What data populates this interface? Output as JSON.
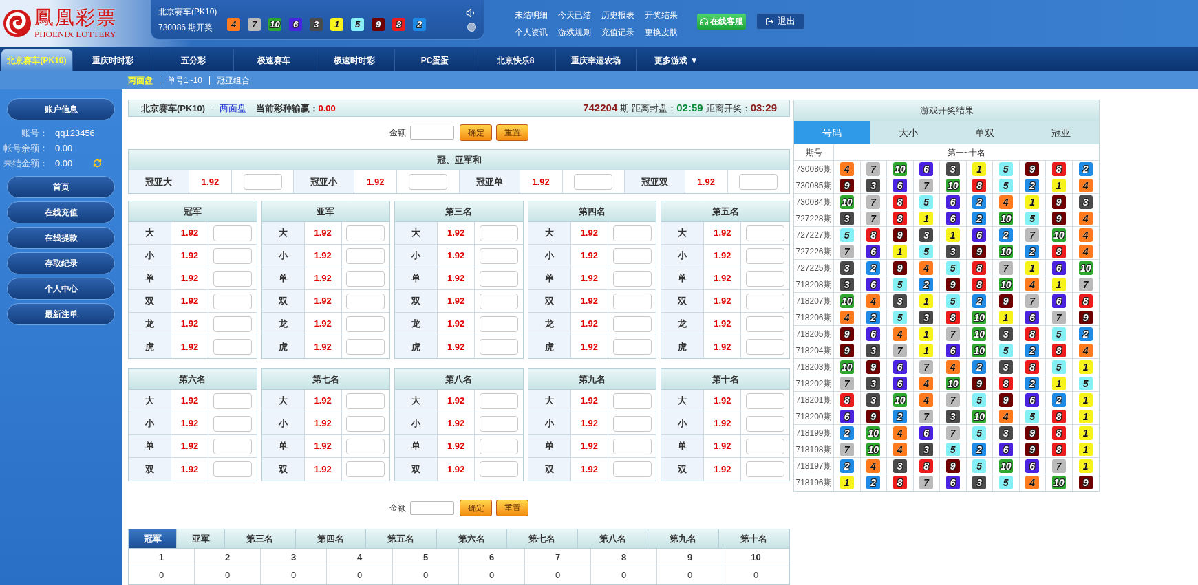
{
  "logo": {
    "title": "鳳凰彩票",
    "subtitle": "PHOENIX LOTTERY"
  },
  "latest": {
    "game": "北京赛车(PK10)",
    "period": "730086 期开奖",
    "balls": [
      {
        "n": "4",
        "color": "#ff7a1c"
      },
      {
        "n": "7",
        "color": "#bababa"
      },
      {
        "n": "10",
        "color": "#2fa82f"
      },
      {
        "n": "6",
        "color": "#4b22e0"
      },
      {
        "n": "3",
        "color": "#4a4a4a"
      },
      {
        "n": "1",
        "color": "#f7f21a"
      },
      {
        "n": "5",
        "color": "#82f0f5"
      },
      {
        "n": "9",
        "color": "#700000"
      },
      {
        "n": "8",
        "color": "#ec1c1c"
      },
      {
        "n": "2",
        "color": "#1e8ce6"
      }
    ]
  },
  "top_links": [
    "未结明细",
    "今天已结",
    "历史报表",
    "开奖结果",
    "个人资讯",
    "游戏规则",
    "充值记录",
    "更换皮肤"
  ],
  "support_button": "在线客服",
  "logout_button": "退出",
  "nav_tabs": [
    {
      "label": "北京赛车(PK10)",
      "selected": true
    },
    {
      "label": "重庆时时彩",
      "selected": false
    },
    {
      "label": "五分彩",
      "selected": false
    },
    {
      "label": "极速赛车",
      "selected": false
    },
    {
      "label": "极速时时彩",
      "selected": false
    },
    {
      "label": "PC蛋蛋",
      "selected": false
    },
    {
      "label": "北京快乐8",
      "selected": false
    },
    {
      "label": "重庆幸运农场",
      "selected": false
    },
    {
      "label": "更多游戏 ▼",
      "selected": false
    }
  ],
  "subnav": [
    {
      "label": "两面盘",
      "selected": true
    },
    {
      "label": "单号1~10",
      "selected": false
    },
    {
      "label": "冠亚组合",
      "selected": false
    }
  ],
  "sidebar": {
    "title": "账户信息",
    "fields": [
      {
        "label": "账号：",
        "value": "qq123456"
      },
      {
        "label": "帐号余额：",
        "value": "0.00"
      },
      {
        "label": "未结金额：",
        "value": "0.00"
      }
    ],
    "menu": [
      "首页",
      "在线充值",
      "在线提款",
      "存取纪录",
      "个人中心",
      "最新注单"
    ]
  },
  "bet_header": {
    "game": "北京赛车(PK10)",
    "separator": "-",
    "market": "两面盘",
    "profit_label": "当前彩种输赢：",
    "profit": "0.00",
    "period": "742204",
    "period_suffix": "期",
    "close_label": "距离封盘：",
    "close_time": "02:59",
    "open_label": "距离开奖：",
    "open_time": "03:29"
  },
  "amount_bar_top": {
    "label": "金额",
    "confirm": "确定",
    "reset": "重置"
  },
  "sum_section": {
    "title": "冠、亚军和",
    "options": [
      {
        "label": "冠亚大",
        "odds": "1.92"
      },
      {
        "label": "冠亚小",
        "odds": "1.92"
      },
      {
        "label": "冠亚单",
        "odds": "1.92"
      },
      {
        "label": "冠亚双",
        "odds": "1.92"
      }
    ]
  },
  "positions_row1": [
    {
      "title": "冠军",
      "options": [
        {
          "label": "大",
          "odds": "1.92"
        },
        {
          "label": "小",
          "odds": "1.92"
        },
        {
          "label": "单",
          "odds": "1.92"
        },
        {
          "label": "双",
          "odds": "1.92"
        },
        {
          "label": "龙",
          "odds": "1.92"
        },
        {
          "label": "虎",
          "odds": "1.92"
        }
      ]
    },
    {
      "title": "亚军",
      "options": [
        {
          "label": "大",
          "odds": "1.92"
        },
        {
          "label": "小",
          "odds": "1.92"
        },
        {
          "label": "单",
          "odds": "1.92"
        },
        {
          "label": "双",
          "odds": "1.92"
        },
        {
          "label": "龙",
          "odds": "1.92"
        },
        {
          "label": "虎",
          "odds": "1.92"
        }
      ]
    },
    {
      "title": "第三名",
      "options": [
        {
          "label": "大",
          "odds": "1.92"
        },
        {
          "label": "小",
          "odds": "1.92"
        },
        {
          "label": "单",
          "odds": "1.92"
        },
        {
          "label": "双",
          "odds": "1.92"
        },
        {
          "label": "龙",
          "odds": "1.92"
        },
        {
          "label": "虎",
          "odds": "1.92"
        }
      ]
    },
    {
      "title": "第四名",
      "options": [
        {
          "label": "大",
          "odds": "1.92"
        },
        {
          "label": "小",
          "odds": "1.92"
        },
        {
          "label": "单",
          "odds": "1.92"
        },
        {
          "label": "双",
          "odds": "1.92"
        },
        {
          "label": "龙",
          "odds": "1.92"
        },
        {
          "label": "虎",
          "odds": "1.92"
        }
      ]
    },
    {
      "title": "第五名",
      "options": [
        {
          "label": "大",
          "odds": "1.92"
        },
        {
          "label": "小",
          "odds": "1.92"
        },
        {
          "label": "单",
          "odds": "1.92"
        },
        {
          "label": "双",
          "odds": "1.92"
        },
        {
          "label": "龙",
          "odds": "1.92"
        },
        {
          "label": "虎",
          "odds": "1.92"
        }
      ]
    }
  ],
  "positions_row2": [
    {
      "title": "第六名",
      "options": [
        {
          "label": "大",
          "odds": "1.92"
        },
        {
          "label": "小",
          "odds": "1.92"
        },
        {
          "label": "单",
          "odds": "1.92"
        },
        {
          "label": "双",
          "odds": "1.92"
        }
      ]
    },
    {
      "title": "第七名",
      "options": [
        {
          "label": "大",
          "odds": "1.92"
        },
        {
          "label": "小",
          "odds": "1.92"
        },
        {
          "label": "单",
          "odds": "1.92"
        },
        {
          "label": "双",
          "odds": "1.92"
        }
      ]
    },
    {
      "title": "第八名",
      "options": [
        {
          "label": "大",
          "odds": "1.92"
        },
        {
          "label": "小",
          "odds": "1.92"
        },
        {
          "label": "单",
          "odds": "1.92"
        },
        {
          "label": "双",
          "odds": "1.92"
        }
      ]
    },
    {
      "title": "第九名",
      "options": [
        {
          "label": "大",
          "odds": "1.92"
        },
        {
          "label": "小",
          "odds": "1.92"
        },
        {
          "label": "单",
          "odds": "1.92"
        },
        {
          "label": "双",
          "odds": "1.92"
        }
      ]
    },
    {
      "title": "第十名",
      "options": [
        {
          "label": "大",
          "odds": "1.92"
        },
        {
          "label": "小",
          "odds": "1.92"
        },
        {
          "label": "单",
          "odds": "1.92"
        },
        {
          "label": "双",
          "odds": "1.92"
        }
      ]
    }
  ],
  "amount_bar_bottom": {
    "label": "金额",
    "confirm": "确定",
    "reset": "重置"
  },
  "stats_table": {
    "tabs": [
      {
        "label": "冠军",
        "selected": true
      },
      {
        "label": "亚军",
        "selected": false
      },
      {
        "label": "第三名",
        "selected": false
      },
      {
        "label": "第四名",
        "selected": false
      },
      {
        "label": "第五名",
        "selected": false
      },
      {
        "label": "第六名",
        "selected": false
      },
      {
        "label": "第七名",
        "selected": false
      },
      {
        "label": "第八名",
        "selected": false
      },
      {
        "label": "第九名",
        "selected": false
      },
      {
        "label": "第十名",
        "selected": false
      }
    ],
    "numbers": [
      "1",
      "2",
      "3",
      "4",
      "5",
      "6",
      "7",
      "8",
      "9",
      "10"
    ],
    "counts": [
      "0",
      "0",
      "0",
      "0",
      "0",
      "0",
      "0",
      "0",
      "0",
      "0"
    ]
  },
  "results": {
    "title": "游戏开奖结果",
    "tabs": [
      {
        "label": "号码",
        "selected": true
      },
      {
        "label": "大小",
        "selected": false
      },
      {
        "label": "单双",
        "selected": false
      },
      {
        "label": "冠亚",
        "selected": false
      }
    ],
    "columns": [
      "期号",
      "第一~十名"
    ],
    "rows": [
      {
        "period": "730086期",
        "balls": [
          {
            "n": "4",
            "color": "#ff7a1c"
          },
          {
            "n": "7",
            "color": "#bababa"
          },
          {
            "n": "10",
            "color": "#2fa82f"
          },
          {
            "n": "6",
            "color": "#4b22e0"
          },
          {
            "n": "3",
            "color": "#4a4a4a"
          },
          {
            "n": "1",
            "color": "#f7f21a"
          },
          {
            "n": "5",
            "color": "#82f0f5"
          },
          {
            "n": "9",
            "color": "#700000"
          },
          {
            "n": "8",
            "color": "#ec1c1c"
          },
          {
            "n": "2",
            "color": "#1e8ce6"
          }
        ]
      },
      {
        "period": "730085期",
        "balls": [
          {
            "n": "9",
            "color": "#700000"
          },
          {
            "n": "3",
            "color": "#4a4a4a"
          },
          {
            "n": "6",
            "color": "#4b22e0"
          },
          {
            "n": "7",
            "color": "#bababa"
          },
          {
            "n": "10",
            "color": "#2fa82f"
          },
          {
            "n": "8",
            "color": "#ec1c1c"
          },
          {
            "n": "5",
            "color": "#82f0f5"
          },
          {
            "n": "2",
            "color": "#1e8ce6"
          },
          {
            "n": "1",
            "color": "#f7f21a"
          },
          {
            "n": "4",
            "color": "#ff7a1c"
          }
        ]
      },
      {
        "period": "730084期",
        "balls": [
          {
            "n": "10",
            "color": "#2fa82f"
          },
          {
            "n": "7",
            "color": "#bababa"
          },
          {
            "n": "8",
            "color": "#ec1c1c"
          },
          {
            "n": "5",
            "color": "#82f0f5"
          },
          {
            "n": "6",
            "color": "#4b22e0"
          },
          {
            "n": "2",
            "color": "#1e8ce6"
          },
          {
            "n": "4",
            "color": "#ff7a1c"
          },
          {
            "n": "1",
            "color": "#f7f21a"
          },
          {
            "n": "9",
            "color": "#700000"
          },
          {
            "n": "3",
            "color": "#4a4a4a"
          }
        ]
      },
      {
        "period": "727228期",
        "balls": [
          {
            "n": "3",
            "color": "#4a4a4a"
          },
          {
            "n": "7",
            "color": "#bababa"
          },
          {
            "n": "8",
            "color": "#ec1c1c"
          },
          {
            "n": "1",
            "color": "#f7f21a"
          },
          {
            "n": "6",
            "color": "#4b22e0"
          },
          {
            "n": "2",
            "color": "#1e8ce6"
          },
          {
            "n": "10",
            "color": "#2fa82f"
          },
          {
            "n": "5",
            "color": "#82f0f5"
          },
          {
            "n": "9",
            "color": "#700000"
          },
          {
            "n": "4",
            "color": "#ff7a1c"
          }
        ]
      },
      {
        "period": "727227期",
        "balls": [
          {
            "n": "5",
            "color": "#82f0f5"
          },
          {
            "n": "8",
            "color": "#ec1c1c"
          },
          {
            "n": "9",
            "color": "#700000"
          },
          {
            "n": "3",
            "color": "#4a4a4a"
          },
          {
            "n": "1",
            "color": "#f7f21a"
          },
          {
            "n": "6",
            "color": "#4b22e0"
          },
          {
            "n": "2",
            "color": "#1e8ce6"
          },
          {
            "n": "7",
            "color": "#bababa"
          },
          {
            "n": "10",
            "color": "#2fa82f"
          },
          {
            "n": "4",
            "color": "#ff7a1c"
          }
        ]
      },
      {
        "period": "727226期",
        "balls": [
          {
            "n": "7",
            "color": "#bababa"
          },
          {
            "n": "6",
            "color": "#4b22e0"
          },
          {
            "n": "1",
            "color": "#f7f21a"
          },
          {
            "n": "5",
            "color": "#82f0f5"
          },
          {
            "n": "3",
            "color": "#4a4a4a"
          },
          {
            "n": "9",
            "color": "#700000"
          },
          {
            "n": "10",
            "color": "#2fa82f"
          },
          {
            "n": "2",
            "color": "#1e8ce6"
          },
          {
            "n": "8",
            "color": "#ec1c1c"
          },
          {
            "n": "4",
            "color": "#ff7a1c"
          }
        ]
      },
      {
        "period": "727225期",
        "balls": [
          {
            "n": "3",
            "color": "#4a4a4a"
          },
          {
            "n": "2",
            "color": "#1e8ce6"
          },
          {
            "n": "9",
            "color": "#700000"
          },
          {
            "n": "4",
            "color": "#ff7a1c"
          },
          {
            "n": "5",
            "color": "#82f0f5"
          },
          {
            "n": "8",
            "color": "#ec1c1c"
          },
          {
            "n": "7",
            "color": "#bababa"
          },
          {
            "n": "1",
            "color": "#f7f21a"
          },
          {
            "n": "6",
            "color": "#4b22e0"
          },
          {
            "n": "10",
            "color": "#2fa82f"
          }
        ]
      },
      {
        "period": "718208期",
        "balls": [
          {
            "n": "3",
            "color": "#4a4a4a"
          },
          {
            "n": "6",
            "color": "#4b22e0"
          },
          {
            "n": "5",
            "color": "#82f0f5"
          },
          {
            "n": "2",
            "color": "#1e8ce6"
          },
          {
            "n": "9",
            "color": "#700000"
          },
          {
            "n": "8",
            "color": "#ec1c1c"
          },
          {
            "n": "10",
            "color": "#2fa82f"
          },
          {
            "n": "4",
            "color": "#ff7a1c"
          },
          {
            "n": "1",
            "color": "#f7f21a"
          },
          {
            "n": "7",
            "color": "#bababa"
          }
        ]
      },
      {
        "period": "718207期",
        "balls": [
          {
            "n": "10",
            "color": "#2fa82f"
          },
          {
            "n": "4",
            "color": "#ff7a1c"
          },
          {
            "n": "3",
            "color": "#4a4a4a"
          },
          {
            "n": "1",
            "color": "#f7f21a"
          },
          {
            "n": "5",
            "color": "#82f0f5"
          },
          {
            "n": "2",
            "color": "#1e8ce6"
          },
          {
            "n": "9",
            "color": "#700000"
          },
          {
            "n": "7",
            "color": "#bababa"
          },
          {
            "n": "6",
            "color": "#4b22e0"
          },
          {
            "n": "8",
            "color": "#ec1c1c"
          }
        ]
      },
      {
        "period": "718206期",
        "balls": [
          {
            "n": "4",
            "color": "#ff7a1c"
          },
          {
            "n": "2",
            "color": "#1e8ce6"
          },
          {
            "n": "5",
            "color": "#82f0f5"
          },
          {
            "n": "3",
            "color": "#4a4a4a"
          },
          {
            "n": "8",
            "color": "#ec1c1c"
          },
          {
            "n": "10",
            "color": "#2fa82f"
          },
          {
            "n": "1",
            "color": "#f7f21a"
          },
          {
            "n": "6",
            "color": "#4b22e0"
          },
          {
            "n": "7",
            "color": "#bababa"
          },
          {
            "n": "9",
            "color": "#700000"
          }
        ]
      },
      {
        "period": "718205期",
        "balls": [
          {
            "n": "9",
            "color": "#700000"
          },
          {
            "n": "6",
            "color": "#4b22e0"
          },
          {
            "n": "4",
            "color": "#ff7a1c"
          },
          {
            "n": "1",
            "color": "#f7f21a"
          },
          {
            "n": "7",
            "color": "#bababa"
          },
          {
            "n": "10",
            "color": "#2fa82f"
          },
          {
            "n": "3",
            "color": "#4a4a4a"
          },
          {
            "n": "8",
            "color": "#ec1c1c"
          },
          {
            "n": "5",
            "color": "#82f0f5"
          },
          {
            "n": "2",
            "color": "#1e8ce6"
          }
        ]
      },
      {
        "period": "718204期",
        "balls": [
          {
            "n": "9",
            "color": "#700000"
          },
          {
            "n": "3",
            "color": "#4a4a4a"
          },
          {
            "n": "7",
            "color": "#bababa"
          },
          {
            "n": "1",
            "color": "#f7f21a"
          },
          {
            "n": "6",
            "color": "#4b22e0"
          },
          {
            "n": "10",
            "color": "#2fa82f"
          },
          {
            "n": "5",
            "color": "#82f0f5"
          },
          {
            "n": "2",
            "color": "#1e8ce6"
          },
          {
            "n": "8",
            "color": "#ec1c1c"
          },
          {
            "n": "4",
            "color": "#ff7a1c"
          }
        ]
      },
      {
        "period": "718203期",
        "balls": [
          {
            "n": "10",
            "color": "#2fa82f"
          },
          {
            "n": "9",
            "color": "#700000"
          },
          {
            "n": "6",
            "color": "#4b22e0"
          },
          {
            "n": "7",
            "color": "#bababa"
          },
          {
            "n": "4",
            "color": "#ff7a1c"
          },
          {
            "n": "2",
            "color": "#1e8ce6"
          },
          {
            "n": "3",
            "color": "#4a4a4a"
          },
          {
            "n": "8",
            "color": "#ec1c1c"
          },
          {
            "n": "5",
            "color": "#82f0f5"
          },
          {
            "n": "1",
            "color": "#f7f21a"
          }
        ]
      },
      {
        "period": "718202期",
        "balls": [
          {
            "n": "7",
            "color": "#bababa"
          },
          {
            "n": "3",
            "color": "#4a4a4a"
          },
          {
            "n": "6",
            "color": "#4b22e0"
          },
          {
            "n": "4",
            "color": "#ff7a1c"
          },
          {
            "n": "10",
            "color": "#2fa82f"
          },
          {
            "n": "9",
            "color": "#700000"
          },
          {
            "n": "8",
            "color": "#ec1c1c"
          },
          {
            "n": "2",
            "color": "#1e8ce6"
          },
          {
            "n": "1",
            "color": "#f7f21a"
          },
          {
            "n": "5",
            "color": "#82f0f5"
          }
        ]
      },
      {
        "period": "718201期",
        "balls": [
          {
            "n": "8",
            "color": "#ec1c1c"
          },
          {
            "n": "3",
            "color": "#4a4a4a"
          },
          {
            "n": "10",
            "color": "#2fa82f"
          },
          {
            "n": "4",
            "color": "#ff7a1c"
          },
          {
            "n": "7",
            "color": "#bababa"
          },
          {
            "n": "5",
            "color": "#82f0f5"
          },
          {
            "n": "9",
            "color": "#700000"
          },
          {
            "n": "6",
            "color": "#4b22e0"
          },
          {
            "n": "2",
            "color": "#1e8ce6"
          },
          {
            "n": "1",
            "color": "#f7f21a"
          }
        ]
      },
      {
        "period": "718200期",
        "balls": [
          {
            "n": "6",
            "color": "#4b22e0"
          },
          {
            "n": "9",
            "color": "#700000"
          },
          {
            "n": "2",
            "color": "#1e8ce6"
          },
          {
            "n": "7",
            "color": "#bababa"
          },
          {
            "n": "3",
            "color": "#4a4a4a"
          },
          {
            "n": "10",
            "color": "#2fa82f"
          },
          {
            "n": "4",
            "color": "#ff7a1c"
          },
          {
            "n": "5",
            "color": "#82f0f5"
          },
          {
            "n": "8",
            "color": "#ec1c1c"
          },
          {
            "n": "1",
            "color": "#f7f21a"
          }
        ]
      },
      {
        "period": "718199期",
        "balls": [
          {
            "n": "2",
            "color": "#1e8ce6"
          },
          {
            "n": "10",
            "color": "#2fa82f"
          },
          {
            "n": "4",
            "color": "#ff7a1c"
          },
          {
            "n": "6",
            "color": "#4b22e0"
          },
          {
            "n": "7",
            "color": "#bababa"
          },
          {
            "n": "5",
            "color": "#82f0f5"
          },
          {
            "n": "3",
            "color": "#4a4a4a"
          },
          {
            "n": "9",
            "color": "#700000"
          },
          {
            "n": "8",
            "color": "#ec1c1c"
          },
          {
            "n": "1",
            "color": "#f7f21a"
          }
        ]
      },
      {
        "period": "718198期",
        "balls": [
          {
            "n": "7",
            "color": "#bababa"
          },
          {
            "n": "10",
            "color": "#2fa82f"
          },
          {
            "n": "4",
            "color": "#ff7a1c"
          },
          {
            "n": "3",
            "color": "#4a4a4a"
          },
          {
            "n": "5",
            "color": "#82f0f5"
          },
          {
            "n": "2",
            "color": "#1e8ce6"
          },
          {
            "n": "6",
            "color": "#4b22e0"
          },
          {
            "n": "9",
            "color": "#700000"
          },
          {
            "n": "8",
            "color": "#ec1c1c"
          },
          {
            "n": "1",
            "color": "#f7f21a"
          }
        ]
      },
      {
        "period": "718197期",
        "balls": [
          {
            "n": "2",
            "color": "#1e8ce6"
          },
          {
            "n": "4",
            "color": "#ff7a1c"
          },
          {
            "n": "3",
            "color": "#4a4a4a"
          },
          {
            "n": "8",
            "color": "#ec1c1c"
          },
          {
            "n": "9",
            "color": "#700000"
          },
          {
            "n": "5",
            "color": "#82f0f5"
          },
          {
            "n": "10",
            "color": "#2fa82f"
          },
          {
            "n": "6",
            "color": "#4b22e0"
          },
          {
            "n": "7",
            "color": "#bababa"
          },
          {
            "n": "1",
            "color": "#f7f21a"
          }
        ]
      },
      {
        "period": "718196期",
        "balls": [
          {
            "n": "1",
            "color": "#f7f21a"
          },
          {
            "n": "2",
            "color": "#1e8ce6"
          },
          {
            "n": "8",
            "color": "#ec1c1c"
          },
          {
            "n": "7",
            "color": "#bababa"
          },
          {
            "n": "6",
            "color": "#4b22e0"
          },
          {
            "n": "3",
            "color": "#4a4a4a"
          },
          {
            "n": "5",
            "color": "#82f0f5"
          },
          {
            "n": "4",
            "color": "#ff7a1c"
          },
          {
            "n": "10",
            "color": "#2fa82f"
          },
          {
            "n": "9",
            "color": "#700000"
          }
        ]
      }
    ]
  }
}
